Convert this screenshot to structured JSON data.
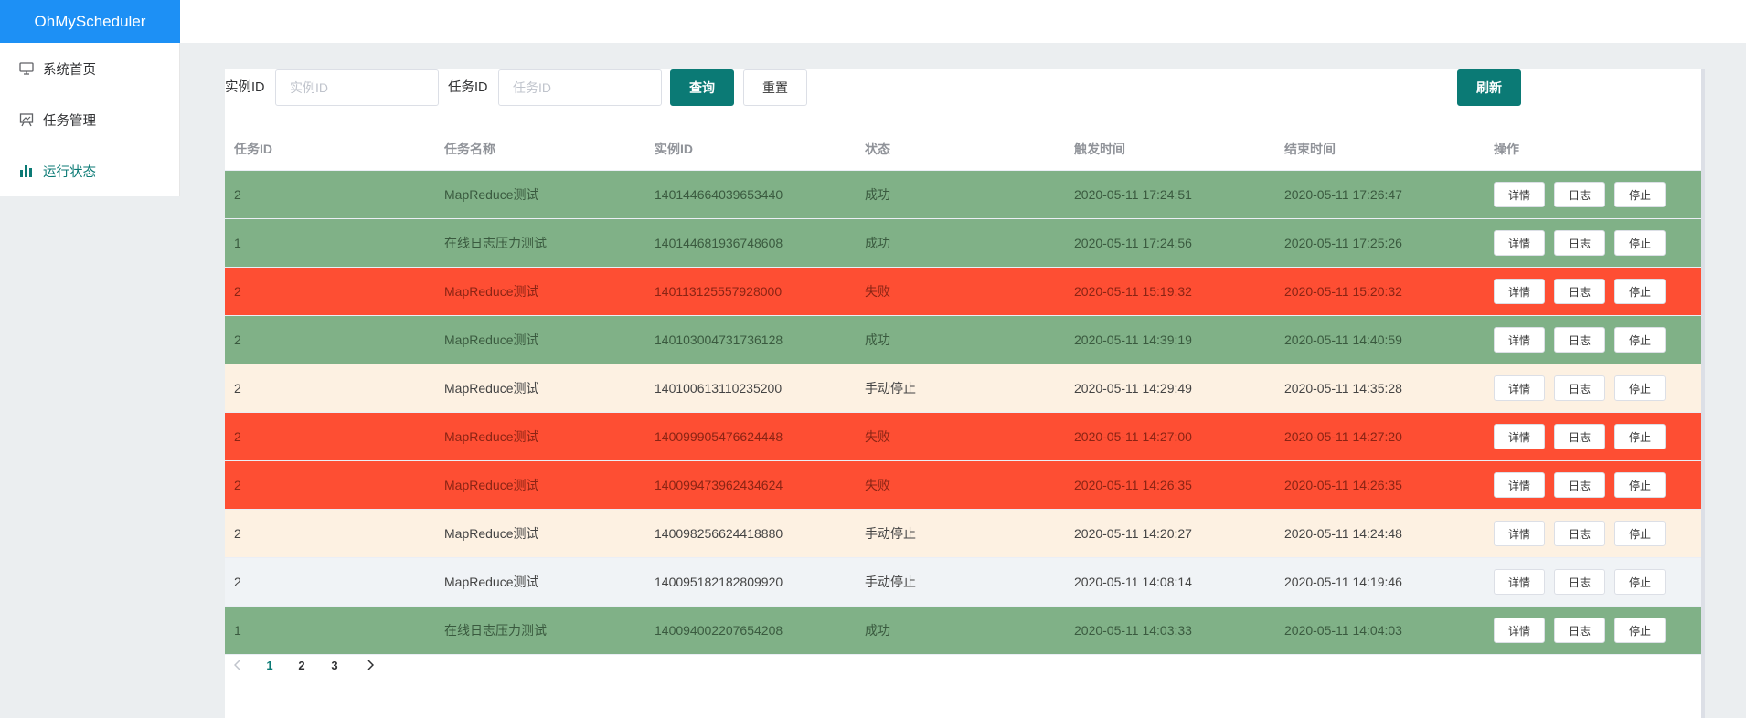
{
  "app": {
    "title": "OhMyScheduler"
  },
  "sidebar": {
    "items": [
      {
        "label": "系统首页",
        "icon": "monitor-icon"
      },
      {
        "label": "任务管理",
        "icon": "presentation-icon"
      },
      {
        "label": "运行状态",
        "icon": "bar-chart-icon",
        "active": true
      }
    ]
  },
  "filters": {
    "instance_label": "实例ID",
    "instance_placeholder": "实例ID",
    "instance_value": "",
    "job_label": "任务ID",
    "job_placeholder": "任务ID",
    "job_value": "",
    "query_label": "查询",
    "reset_label": "重置",
    "refresh_label": "刷新"
  },
  "table": {
    "columns": [
      "任务ID",
      "任务名称",
      "实例ID",
      "状态",
      "触发时间",
      "结束时间",
      "操作"
    ],
    "action_labels": {
      "detail": "详情",
      "log": "日志",
      "stop": "停止"
    },
    "status_colors": {
      "success": "#80b187",
      "failed": "#fe4e33",
      "stopped": "#fdf1e2",
      "waiting": "#f0f3f6"
    },
    "rows": [
      {
        "job_id": "2",
        "job_name": "MapReduce测试",
        "instance_id": "140144664039653440",
        "status": "成功",
        "kind": "success",
        "trigger_time": "2020-05-11 17:24:51",
        "end_time": "2020-05-11 17:26:47"
      },
      {
        "job_id": "1",
        "job_name": "在线日志压力测试",
        "instance_id": "140144681936748608",
        "status": "成功",
        "kind": "success",
        "trigger_time": "2020-05-11 17:24:56",
        "end_time": "2020-05-11 17:25:26"
      },
      {
        "job_id": "2",
        "job_name": "MapReduce测试",
        "instance_id": "140113125557928000",
        "status": "失败",
        "kind": "failed",
        "trigger_time": "2020-05-11 15:19:32",
        "end_time": "2020-05-11 15:20:32"
      },
      {
        "job_id": "2",
        "job_name": "MapReduce测试",
        "instance_id": "140103004731736128",
        "status": "成功",
        "kind": "success",
        "trigger_time": "2020-05-11 14:39:19",
        "end_time": "2020-05-11 14:40:59"
      },
      {
        "job_id": "2",
        "job_name": "MapReduce测试",
        "instance_id": "140100613110235200",
        "status": "手动停止",
        "kind": "stopped",
        "trigger_time": "2020-05-11 14:29:49",
        "end_time": "2020-05-11 14:35:28"
      },
      {
        "job_id": "2",
        "job_name": "MapReduce测试",
        "instance_id": "140099905476624448",
        "status": "失败",
        "kind": "failed",
        "trigger_time": "2020-05-11 14:27:00",
        "end_time": "2020-05-11 14:27:20"
      },
      {
        "job_id": "2",
        "job_name": "MapReduce测试",
        "instance_id": "140099473962434624",
        "status": "失败",
        "kind": "failed",
        "trigger_time": "2020-05-11 14:26:35",
        "end_time": "2020-05-11 14:26:35"
      },
      {
        "job_id": "2",
        "job_name": "MapReduce测试",
        "instance_id": "140098256624418880",
        "status": "手动停止",
        "kind": "stopped",
        "trigger_time": "2020-05-11 14:20:27",
        "end_time": "2020-05-11 14:24:48"
      },
      {
        "job_id": "2",
        "job_name": "MapReduce测试",
        "instance_id": "140095182182809920",
        "status": "手动停止",
        "kind": "waiting",
        "trigger_time": "2020-05-11 14:08:14",
        "end_time": "2020-05-11 14:19:46"
      },
      {
        "job_id": "1",
        "job_name": "在线日志压力测试",
        "instance_id": "140094002207654208",
        "status": "成功",
        "kind": "success",
        "trigger_time": "2020-05-11 14:03:33",
        "end_time": "2020-05-11 14:04:03"
      }
    ]
  },
  "pagination": {
    "prev_icon": "chevron-left-icon",
    "next_icon": "chevron-right-icon",
    "pages": [
      "1",
      "2",
      "3"
    ],
    "current": "1"
  }
}
